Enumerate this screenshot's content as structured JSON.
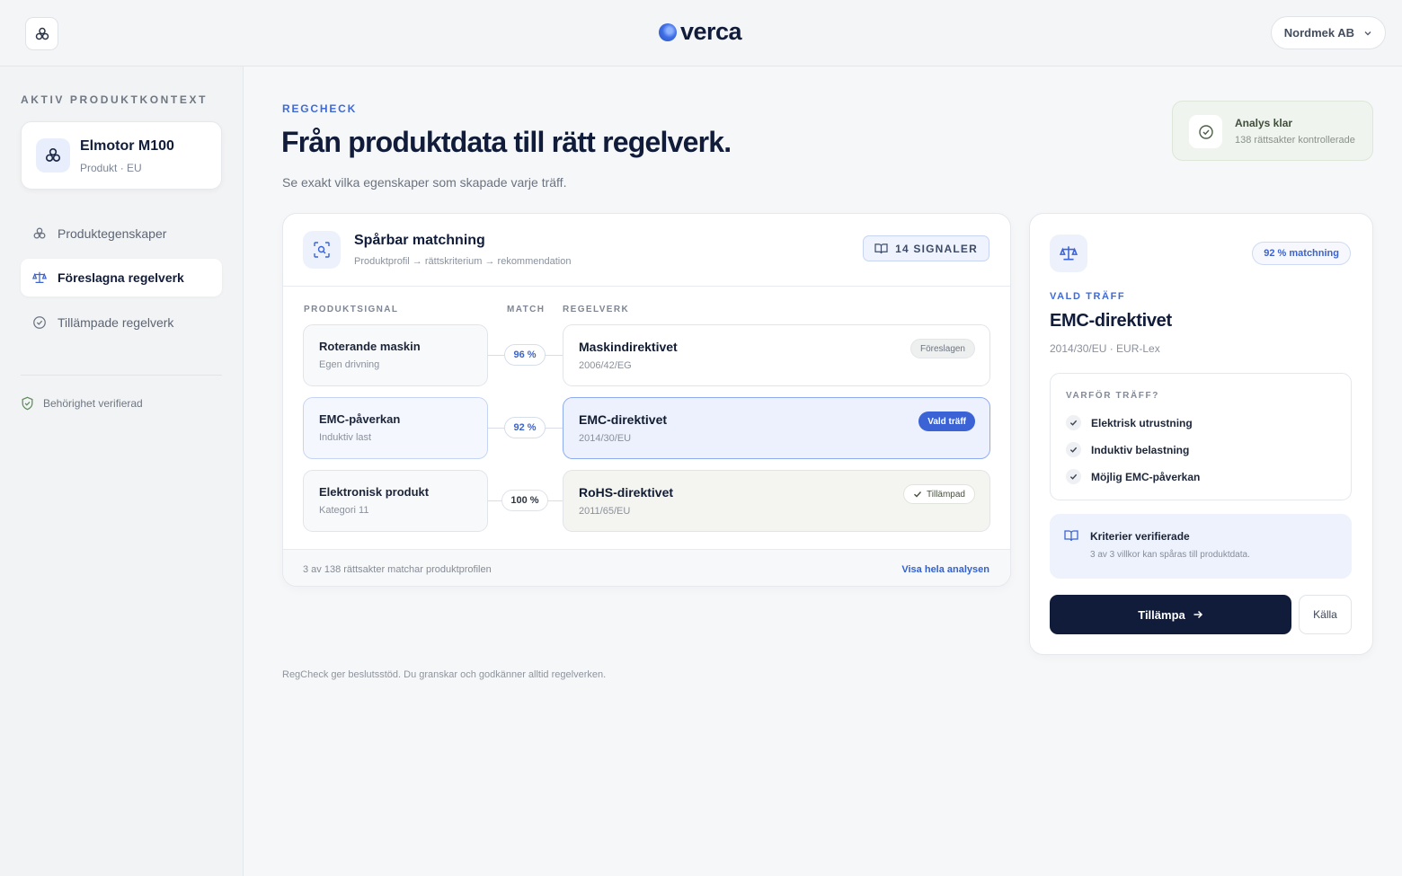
{
  "header": {
    "logo_text": "verca",
    "org": "Nordmek AB"
  },
  "sidebar": {
    "section_label": "AKTIV PRODUKTKONTEXT",
    "product": {
      "name": "Elmotor M100",
      "sub": "Produkt · EU"
    },
    "items": [
      {
        "label": "Produktegenskaper",
        "icon": "components-icon",
        "active": false
      },
      {
        "label": "Föreslagna regelverk",
        "icon": "scale-icon",
        "active": true
      },
      {
        "label": "Tillämpade regelverk",
        "icon": "check-circle-icon",
        "active": false
      }
    ],
    "verified_label": "Behörighet verifierad"
  },
  "main": {
    "eyebrow": "REGCHECK",
    "title": "Från produktdata till rätt regelverk.",
    "subtitle": "Se exakt vilka egenskaper som skapade varje träff.",
    "status": {
      "title": "Analys klar",
      "sub": "138 rättsakter kontrollerade"
    },
    "disclaimer": "RegCheck ger beslutsstöd. Du granskar och godkänner alltid regelverken."
  },
  "matching": {
    "title": "Spårbar matchning",
    "sub": "Produktprofil → rättskriterium → rekommendation",
    "signals_label": "14 SIGNALER",
    "columns": {
      "signal": "PRODUKTSIGNAL",
      "match": "MATCH",
      "regulation": "REGELVERK"
    },
    "rows": [
      {
        "signal": "Roterande maskin",
        "signal_sub": "Egen drivning",
        "match": "96 %",
        "regulation": "Maskindirektivet",
        "regulation_sub": "2006/42/EG",
        "badge": "Föreslagen",
        "state": "suggested"
      },
      {
        "signal": "EMC-påverkan",
        "signal_sub": "Induktiv last",
        "match": "92 %",
        "regulation": "EMC-direktivet",
        "regulation_sub": "2014/30/EU",
        "badge": "Vald träff",
        "state": "selected"
      },
      {
        "signal": "Elektronisk produkt",
        "signal_sub": "Kategori 11",
        "match": "100 %",
        "regulation": "RoHS-direktivet",
        "regulation_sub": "2011/65/EU",
        "badge": "Tillämpad",
        "state": "applied"
      }
    ],
    "footer_text": "3 av 138 rättsakter matchar produktprofilen",
    "footer_link": "Visa hela analysen"
  },
  "detail": {
    "match_pill": "92 % matchning",
    "eyebrow": "VALD TRÄFF",
    "title": "EMC-direktivet",
    "sub": "2014/30/EU · EUR-Lex",
    "why_head": "VARFÖR TRÄFF?",
    "reasons": [
      "Elektrisk utrustning",
      "Induktiv belastning",
      "Möjlig EMC-påverkan"
    ],
    "criteria_title": "Kriterier verifierade",
    "criteria_sub": "3 av 3 villkor kan spåras till produktdata.",
    "apply_label": "Tillämpa",
    "source_label": "Källa"
  },
  "colors": {
    "accent": "#3b63d6",
    "navy": "#111c3b",
    "success_bg": "#f0f4ee"
  }
}
